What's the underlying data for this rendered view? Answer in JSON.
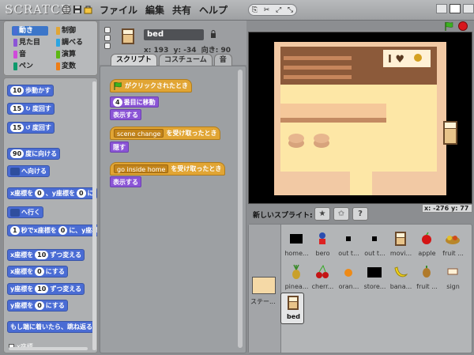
{
  "app": {
    "logo": "SCRATCH"
  },
  "menu": [
    "ファイル",
    "編集",
    "共有",
    "ヘルプ"
  ],
  "palette": {
    "categories": [
      {
        "label": "動き",
        "color": "#4a6cd4",
        "selected": true
      },
      {
        "label": "制御",
        "color": "#e1a534"
      },
      {
        "label": "見た目",
        "color": "#8b55d6"
      },
      {
        "label": "調べる",
        "color": "#2ca5e2"
      },
      {
        "label": "音",
        "color": "#cf4ad9"
      },
      {
        "label": "演算",
        "color": "#5cb712"
      },
      {
        "label": "ペン",
        "color": "#0e9a6c"
      },
      {
        "label": "変数",
        "color": "#ee7d16"
      }
    ],
    "blocks": {
      "move_num": "10",
      "move_text": "歩動かす",
      "turn_r_num": "15",
      "turn_r_text": "度回す",
      "turn_l_num": "15",
      "turn_l_text": "度回す",
      "point_dir_num": "90",
      "point_dir_text": "度に向ける",
      "point_towards_text": "へ向ける",
      "goto_x_text": "x座標を",
      "goto_x_num": "0",
      "goto_y_text": "、y座標を",
      "goto_y_num": "0",
      "goto_end": "に",
      "goto_sprite_text": "へ行く",
      "glide_num": "1",
      "glide_text": "秒でx座標を",
      "glide_x": "0",
      "glide_text2": "に、y座標",
      "change_x_text": "x座標を",
      "change_x_num": "10",
      "change_x_end": "ずつ変える",
      "set_x_text": "x座標を",
      "set_x_num": "0",
      "set_x_end": "にする",
      "change_y_text": "y座標を",
      "change_y_num": "10",
      "change_y_end": "ずつ変える",
      "set_y_text": "y座標を",
      "set_y_num": "0",
      "set_y_end": "にする",
      "bounce_text": "もし端に着いたら、跳ね返る",
      "bottom_checkbox_text": "x座標"
    }
  },
  "sprite": {
    "name": "bed",
    "x_label": "x:",
    "x": "193",
    "y_label": "y:",
    "y": "-34",
    "dir_label": "向き:",
    "dir": "90"
  },
  "tabs": [
    {
      "label": "スクリプト",
      "selected": true
    },
    {
      "label": "コスチューム"
    },
    {
      "label": "音"
    }
  ],
  "scripts": {
    "s1_hat": "がクリックされたとき",
    "s1_b1_num": "4",
    "s1_b1_text": "番目に移動",
    "s1_b2_text": "表示する",
    "s2_hat_msg": "scene change",
    "s2_hat_text": "を受け取ったとき",
    "s2_b1_text": "隠す",
    "s3_hat_msg": "go inside home",
    "s3_hat_text": "を受け取ったとき",
    "s3_b1_text": "表示する"
  },
  "stage": {
    "mouse_x_label": "x:",
    "mouse_x": "-276",
    "mouse_y_label": "y:",
    "mouse_y": "77",
    "sign_text": "I ♥"
  },
  "new_sprite": {
    "label": "新しいスプライト:"
  },
  "library": {
    "stage_label": "ステー...",
    "sprites": [
      {
        "label": "home...",
        "icon": "black-square-icon"
      },
      {
        "label": "bero",
        "icon": "boy-icon"
      },
      {
        "label": "out t...",
        "icon": "small-black-square-icon"
      },
      {
        "label": "out t...",
        "icon": "small-black-square-icon"
      },
      {
        "label": "movi...",
        "icon": "bed-icon"
      },
      {
        "label": "apple",
        "icon": "apple-icon"
      },
      {
        "label": "fruit ...",
        "icon": "fruit-basket-icon"
      },
      {
        "label": "pinea...",
        "icon": "pineapple-icon"
      },
      {
        "label": "cherr...",
        "icon": "cherry-icon"
      },
      {
        "label": "oran...",
        "icon": "orange-icon"
      },
      {
        "label": "store...",
        "icon": "black-rect-icon"
      },
      {
        "label": "bana...",
        "icon": "banana-icon"
      },
      {
        "label": "fruit ...",
        "icon": "fruit-icon"
      },
      {
        "label": "sign",
        "icon": "sign-icon"
      },
      {
        "label": "bed",
        "icon": "bed-icon",
        "selected": true
      }
    ]
  }
}
